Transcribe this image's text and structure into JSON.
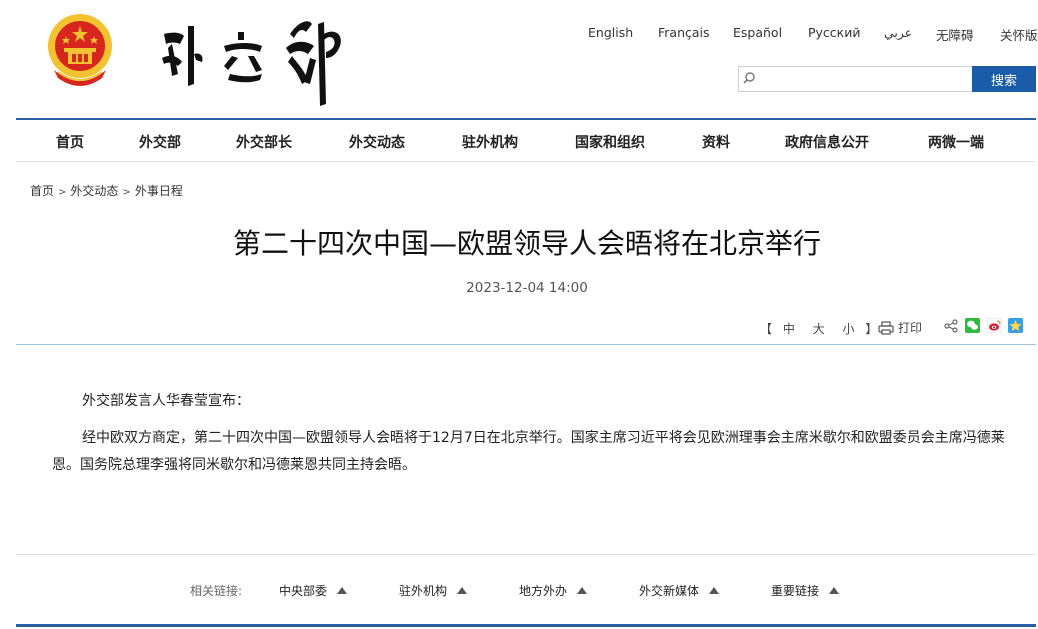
{
  "languages": [
    "English",
    "Français",
    "Español",
    "Русский",
    "عربي",
    "无障碍",
    "关怀版"
  ],
  "search": {
    "placeholder": "",
    "button_label": "搜索"
  },
  "nav": [
    "首页",
    "外交部",
    "外交部长",
    "外交动态",
    "驻外机构",
    "国家和组织",
    "资料",
    "政府信息公开",
    "两微一端"
  ],
  "breadcrumb": [
    "首页",
    "外交动态",
    "外事日程"
  ],
  "article": {
    "title": "第二十四次中国—欧盟领导人会晤将在北京举行",
    "date": "2023-12-04 14:00",
    "paragraphs": [
      "外交部发言人华春莹宣布：",
      "经中欧双方商定，第二十四次中国—欧盟领导人会晤将于12月7日在北京举行。国家主席习近平将会见欧洲理事会主席米歇尔和欧盟委员会主席冯德莱恩。国务院总理李强将同米歇尔和冯德莱恩共同主持会晤。"
    ]
  },
  "tools": {
    "bracket_open": "【",
    "bracket_close": "】",
    "sizes": [
      "中",
      "大",
      "小"
    ],
    "print_label": "打印",
    "share_icons": [
      "share-icon",
      "wechat-icon",
      "weibo-icon",
      "qzone-icon"
    ]
  },
  "footer": {
    "links_label": "相关链接:",
    "links": [
      "中央部委",
      "驻外机构",
      "地方外办",
      "外交新媒体",
      "重要链接"
    ]
  },
  "colors": {
    "brand_blue": "#1a5ca8",
    "nav_border": "#2a5fa5",
    "emblem_red": "#d7261e",
    "emblem_gold": "#f2c230"
  }
}
